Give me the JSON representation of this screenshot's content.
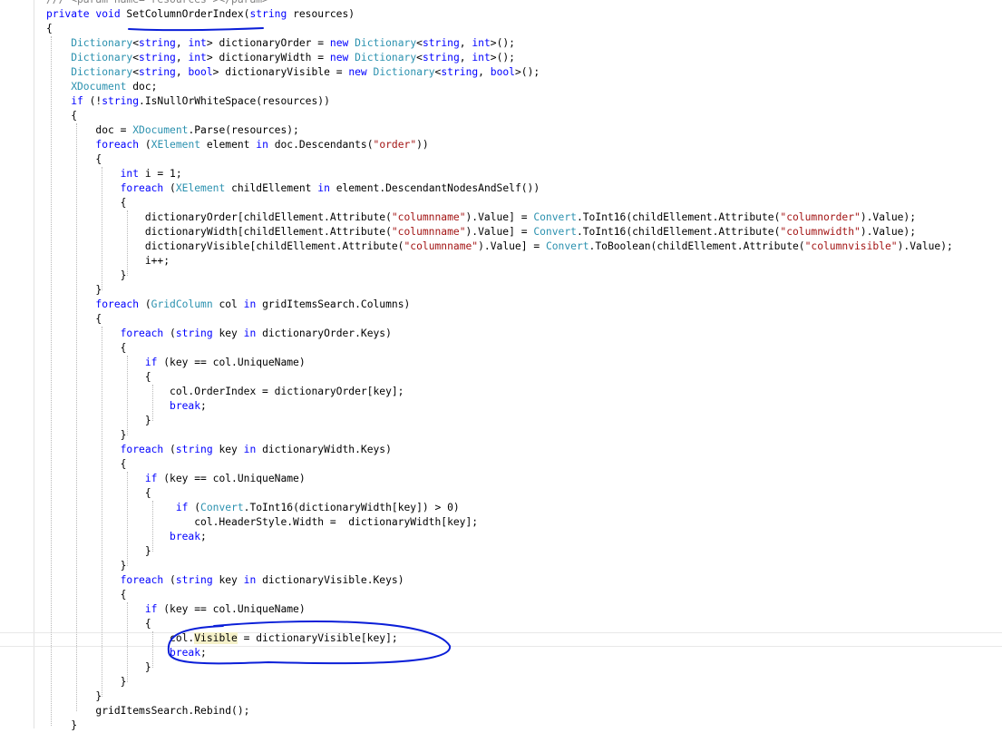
{
  "lines": [
    {
      "tokens": [
        {
          "t": "/// <param name=\"resources\"></param>",
          "c": "cmt"
        }
      ]
    },
    {
      "tokens": [
        {
          "t": "private void ",
          "c": "kw"
        },
        {
          "t": "SetColumnOrderIndex(",
          "c": ""
        },
        {
          "t": "string",
          "c": "kw"
        },
        {
          "t": " resources)",
          "c": ""
        }
      ]
    },
    {
      "tokens": [
        {
          "t": "{",
          "c": ""
        }
      ]
    },
    {
      "tokens": [
        {
          "t": "    Dictionary",
          "c": "type"
        },
        {
          "t": "<",
          "c": ""
        },
        {
          "t": "string",
          "c": "kw"
        },
        {
          "t": ", ",
          "c": ""
        },
        {
          "t": "int",
          "c": "kw"
        },
        {
          "t": "> dictionaryOrder = ",
          "c": ""
        },
        {
          "t": "new ",
          "c": "kw"
        },
        {
          "t": "Dictionary",
          "c": "type"
        },
        {
          "t": "<",
          "c": ""
        },
        {
          "t": "string",
          "c": "kw"
        },
        {
          "t": ", ",
          "c": ""
        },
        {
          "t": "int",
          "c": "kw"
        },
        {
          "t": ">();",
          "c": ""
        }
      ]
    },
    {
      "tokens": [
        {
          "t": "    Dictionary",
          "c": "type"
        },
        {
          "t": "<",
          "c": ""
        },
        {
          "t": "string",
          "c": "kw"
        },
        {
          "t": ", ",
          "c": ""
        },
        {
          "t": "int",
          "c": "kw"
        },
        {
          "t": "> dictionaryWidth = ",
          "c": ""
        },
        {
          "t": "new ",
          "c": "kw"
        },
        {
          "t": "Dictionary",
          "c": "type"
        },
        {
          "t": "<",
          "c": ""
        },
        {
          "t": "string",
          "c": "kw"
        },
        {
          "t": ", ",
          "c": ""
        },
        {
          "t": "int",
          "c": "kw"
        },
        {
          "t": ">();",
          "c": ""
        }
      ]
    },
    {
      "tokens": [
        {
          "t": "    Dictionary",
          "c": "type"
        },
        {
          "t": "<",
          "c": ""
        },
        {
          "t": "string",
          "c": "kw"
        },
        {
          "t": ", ",
          "c": ""
        },
        {
          "t": "bool",
          "c": "kw"
        },
        {
          "t": "> dictionaryVisible = ",
          "c": ""
        },
        {
          "t": "new ",
          "c": "kw"
        },
        {
          "t": "Dictionary",
          "c": "type"
        },
        {
          "t": "<",
          "c": ""
        },
        {
          "t": "string",
          "c": "kw"
        },
        {
          "t": ", ",
          "c": ""
        },
        {
          "t": "bool",
          "c": "kw"
        },
        {
          "t": ">();",
          "c": ""
        }
      ]
    },
    {
      "tokens": [
        {
          "t": "    XDocument",
          "c": "type"
        },
        {
          "t": " doc;",
          "c": ""
        }
      ]
    },
    {
      "tokens": [
        {
          "t": "    if ",
          "c": "kw"
        },
        {
          "t": "(!",
          "c": ""
        },
        {
          "t": "string",
          "c": "kw"
        },
        {
          "t": ".IsNullOrWhiteSpace(resources))",
          "c": ""
        }
      ]
    },
    {
      "tokens": [
        {
          "t": "    {",
          "c": ""
        }
      ]
    },
    {
      "tokens": [
        {
          "t": "        doc = ",
          "c": ""
        },
        {
          "t": "XDocument",
          "c": "type"
        },
        {
          "t": ".Parse(resources);",
          "c": ""
        }
      ]
    },
    {
      "tokens": [
        {
          "t": "        foreach ",
          "c": "kw"
        },
        {
          "t": "(",
          "c": ""
        },
        {
          "t": "XElement",
          "c": "type"
        },
        {
          "t": " element ",
          "c": ""
        },
        {
          "t": "in",
          "c": "kw"
        },
        {
          "t": " doc.Descendants(",
          "c": ""
        },
        {
          "t": "\"order\"",
          "c": "str"
        },
        {
          "t": "))",
          "c": ""
        }
      ]
    },
    {
      "tokens": [
        {
          "t": "        {",
          "c": ""
        }
      ]
    },
    {
      "tokens": [
        {
          "t": "            int",
          "c": "kw"
        },
        {
          "t": " i = 1;",
          "c": ""
        }
      ]
    },
    {
      "tokens": [
        {
          "t": "            foreach ",
          "c": "kw"
        },
        {
          "t": "(",
          "c": ""
        },
        {
          "t": "XElement",
          "c": "type"
        },
        {
          "t": " childEllement ",
          "c": ""
        },
        {
          "t": "in",
          "c": "kw"
        },
        {
          "t": " element.DescendantNodesAndSelf())",
          "c": ""
        }
      ]
    },
    {
      "tokens": [
        {
          "t": "            {",
          "c": ""
        }
      ]
    },
    {
      "tokens": [
        {
          "t": "                dictionaryOrder[childEllement.Attribute(",
          "c": ""
        },
        {
          "t": "\"columnname\"",
          "c": "str"
        },
        {
          "t": ").Value] = ",
          "c": ""
        },
        {
          "t": "Convert",
          "c": "type"
        },
        {
          "t": ".ToInt16(childEllement.Attribute(",
          "c": ""
        },
        {
          "t": "\"columnorder\"",
          "c": "str"
        },
        {
          "t": ").Value);",
          "c": ""
        }
      ]
    },
    {
      "tokens": [
        {
          "t": "                dictionaryWidth[childEllement.Attribute(",
          "c": ""
        },
        {
          "t": "\"columnname\"",
          "c": "str"
        },
        {
          "t": ").Value] = ",
          "c": ""
        },
        {
          "t": "Convert",
          "c": "type"
        },
        {
          "t": ".ToInt16(childEllement.Attribute(",
          "c": ""
        },
        {
          "t": "\"columnwidth\"",
          "c": "str"
        },
        {
          "t": ").Value);",
          "c": ""
        }
      ]
    },
    {
      "tokens": [
        {
          "t": "                dictionaryVisible[childEllement.Attribute(",
          "c": ""
        },
        {
          "t": "\"columnname\"",
          "c": "str"
        },
        {
          "t": ").Value] = ",
          "c": ""
        },
        {
          "t": "Convert",
          "c": "type"
        },
        {
          "t": ".ToBoolean(childEllement.Attribute(",
          "c": ""
        },
        {
          "t": "\"columnvisible\"",
          "c": "str"
        },
        {
          "t": ").Value);",
          "c": ""
        }
      ]
    },
    {
      "tokens": [
        {
          "t": "                i++;",
          "c": ""
        }
      ]
    },
    {
      "tokens": [
        {
          "t": "            }",
          "c": ""
        }
      ]
    },
    {
      "tokens": [
        {
          "t": "        }",
          "c": ""
        }
      ]
    },
    {
      "tokens": [
        {
          "t": "        foreach ",
          "c": "kw"
        },
        {
          "t": "(",
          "c": ""
        },
        {
          "t": "GridColumn",
          "c": "type"
        },
        {
          "t": " col ",
          "c": ""
        },
        {
          "t": "in",
          "c": "kw"
        },
        {
          "t": " gridItemsSearch.Columns)",
          "c": ""
        }
      ]
    },
    {
      "tokens": [
        {
          "t": "        {",
          "c": ""
        }
      ]
    },
    {
      "tokens": [
        {
          "t": "            foreach ",
          "c": "kw"
        },
        {
          "t": "(",
          "c": ""
        },
        {
          "t": "string",
          "c": "kw"
        },
        {
          "t": " key ",
          "c": ""
        },
        {
          "t": "in",
          "c": "kw"
        },
        {
          "t": " dictionaryOrder.Keys)",
          "c": ""
        }
      ]
    },
    {
      "tokens": [
        {
          "t": "            {",
          "c": ""
        }
      ]
    },
    {
      "tokens": [
        {
          "t": "                if ",
          "c": "kw"
        },
        {
          "t": "(key == col.UniqueName)",
          "c": ""
        }
      ]
    },
    {
      "tokens": [
        {
          "t": "                {",
          "c": ""
        }
      ]
    },
    {
      "tokens": [
        {
          "t": "                    col.OrderIndex = dictionaryOrder[key];",
          "c": ""
        }
      ]
    },
    {
      "tokens": [
        {
          "t": "                    break",
          "c": "kw"
        },
        {
          "t": ";",
          "c": ""
        }
      ]
    },
    {
      "tokens": [
        {
          "t": "                }",
          "c": ""
        }
      ]
    },
    {
      "tokens": [
        {
          "t": "            }",
          "c": ""
        }
      ]
    },
    {
      "tokens": [
        {
          "t": "            foreach ",
          "c": "kw"
        },
        {
          "t": "(",
          "c": ""
        },
        {
          "t": "string",
          "c": "kw"
        },
        {
          "t": " key ",
          "c": ""
        },
        {
          "t": "in",
          "c": "kw"
        },
        {
          "t": " dictionaryWidth.Keys)",
          "c": ""
        }
      ]
    },
    {
      "tokens": [
        {
          "t": "            {",
          "c": ""
        }
      ]
    },
    {
      "tokens": [
        {
          "t": "                if ",
          "c": "kw"
        },
        {
          "t": "(key == col.UniqueName)",
          "c": ""
        }
      ]
    },
    {
      "tokens": [
        {
          "t": "                {",
          "c": ""
        }
      ]
    },
    {
      "tokens": [
        {
          "t": "                     if ",
          "c": "kw"
        },
        {
          "t": "(",
          "c": ""
        },
        {
          "t": "Convert",
          "c": "type"
        },
        {
          "t": ".ToInt16(dictionaryWidth[key]) > 0)",
          "c": ""
        }
      ]
    },
    {
      "tokens": [
        {
          "t": "                        col.HeaderStyle.Width =  dictionaryWidth[key];",
          "c": ""
        }
      ]
    },
    {
      "tokens": [
        {
          "t": "                    break",
          "c": "kw"
        },
        {
          "t": ";",
          "c": ""
        }
      ]
    },
    {
      "tokens": [
        {
          "t": "                }",
          "c": ""
        }
      ]
    },
    {
      "tokens": [
        {
          "t": "            }",
          "c": ""
        }
      ]
    },
    {
      "tokens": [
        {
          "t": "            foreach ",
          "c": "kw"
        },
        {
          "t": "(",
          "c": ""
        },
        {
          "t": "string",
          "c": "kw"
        },
        {
          "t": " key ",
          "c": ""
        },
        {
          "t": "in",
          "c": "kw"
        },
        {
          "t": " dictionaryVisible.Keys)",
          "c": ""
        }
      ]
    },
    {
      "tokens": [
        {
          "t": "            {",
          "c": ""
        }
      ]
    },
    {
      "tokens": [
        {
          "t": "                if ",
          "c": "kw"
        },
        {
          "t": "(key == col.UniqueName)",
          "c": ""
        }
      ]
    },
    {
      "tokens": [
        {
          "t": "                {",
          "c": ""
        }
      ]
    },
    {
      "tokens": [
        {
          "t": "                    col.",
          "c": ""
        },
        {
          "t": "Visible",
          "c": "hl"
        },
        {
          "t": " = dictionaryVisible[key];",
          "c": ""
        }
      ]
    },
    {
      "tokens": [
        {
          "t": "                    break",
          "c": "kw"
        },
        {
          "t": ";",
          "c": ""
        }
      ]
    },
    {
      "tokens": [
        {
          "t": "                }",
          "c": ""
        }
      ]
    },
    {
      "tokens": [
        {
          "t": "            }",
          "c": ""
        }
      ]
    },
    {
      "tokens": [
        {
          "t": "        }",
          "c": ""
        }
      ]
    },
    {
      "tokens": [
        {
          "t": "        gridItemsSearch.Rebind();",
          "c": ""
        }
      ]
    },
    {
      "tokens": [
        {
          "t": "    }",
          "c": ""
        }
      ]
    }
  ],
  "colors": {
    "keyword": "#0000ff",
    "type": "#2b91af",
    "string": "#a31515",
    "comment": "#808080",
    "annotation": "#0b1fd8"
  }
}
